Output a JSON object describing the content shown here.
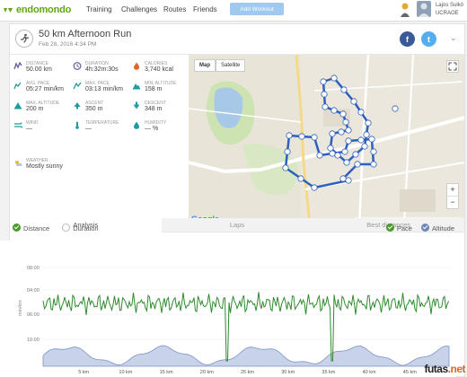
{
  "nav": {
    "brand": "endomondo",
    "links": [
      "Training",
      "Challenges",
      "Routes",
      "Friends"
    ],
    "add_workout": "Add Workout",
    "user_name_1": "Lajos Sulkó",
    "user_name_2": "UCRAOE",
    "brand_color": "#61a60e"
  },
  "workout": {
    "title": "50 km Afternoon Run",
    "date": "Feb 28, 2016 4:34 PM",
    "share": [
      "f",
      "t"
    ],
    "chevron": "⌄"
  },
  "stats": [
    {
      "label": "Distance",
      "value": "50.00 km",
      "icon": "distance-icon"
    },
    {
      "label": "Duration",
      "value": "4h:32m:30s",
      "icon": "duration-icon"
    },
    {
      "label": "Calories",
      "value": "3,740 kcal",
      "icon": "calories-icon"
    },
    {
      "label": "Avg. Pace",
      "value": "05:27 min/km",
      "icon": "avg-pace-icon"
    },
    {
      "label": "Max. Pace",
      "value": "03:13 min/km",
      "icon": "max-pace-icon"
    },
    {
      "label": "Min. Altitude",
      "value": "158 m",
      "icon": "min-altitude-icon"
    },
    {
      "label": "Max. Altitude",
      "value": "200 m",
      "icon": "max-altitude-icon"
    },
    {
      "label": "Ascent",
      "value": "350 m",
      "icon": "ascent-icon"
    },
    {
      "label": "Descent",
      "value": "348 m",
      "icon": "descent-icon"
    },
    {
      "label": "Wind",
      "value": "—",
      "icon": "wind-icon"
    },
    {
      "label": "Temperature",
      "value": "—",
      "icon": "temperature-icon"
    },
    {
      "label": "Humidity",
      "value": "— %",
      "icon": "humidity-icon"
    },
    {
      "label": "Weather",
      "value": "Mostly sunny",
      "icon": "weather-icon"
    }
  ],
  "map": {
    "buttons": [
      "Map",
      "Satellite"
    ],
    "zoom_in": "+",
    "zoom_out": "−",
    "google": "Google",
    "footer": "Map data ©2016 Google   Terms of Use   Report a map error"
  },
  "tabs": [
    "Analysis",
    "Laps",
    "Best distances"
  ],
  "legend": {
    "left": [
      "Distance",
      "Duration"
    ],
    "right": [
      "Pace",
      "Altitude"
    ]
  },
  "chart_data": {
    "type": "line",
    "x_ticks": [
      "5 km",
      "10 km",
      "15 km",
      "20 km",
      "25 km",
      "30 km",
      "35 km",
      "40 km",
      "45 km"
    ],
    "y_ticks": [
      "08:00",
      "04:00",
      "06:00",
      "10:00"
    ],
    "ylabel": "min/km",
    "series": [
      {
        "name": "Pace",
        "color": "#2f8a2f"
      },
      {
        "name": "Altitude",
        "color": "#7b93c6"
      }
    ]
  },
  "watermark": {
    "main": "futas",
    "sub": ".net"
  }
}
